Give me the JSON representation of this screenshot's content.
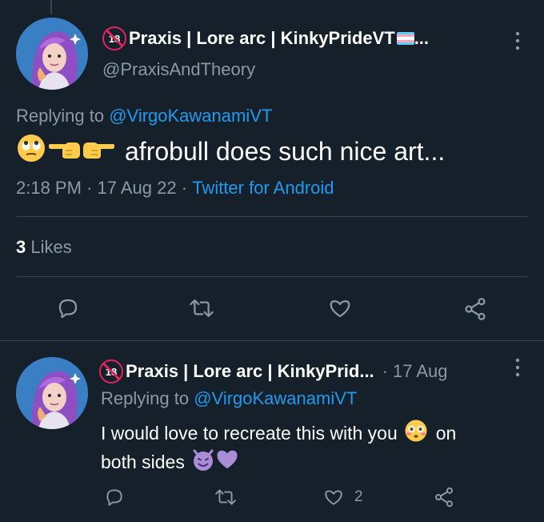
{
  "main_tweet": {
    "display_name": "Praxis | Lore arc | KinkyPrideVT",
    "display_name_ellipsis": "...",
    "handle": "@PraxisAndTheory",
    "age_badge": "18",
    "replying_prefix": "Replying to",
    "replying_to": "@VirgoKawanamiVT",
    "text": "afrobull does such nice art...",
    "time": "2:18 PM",
    "date": "17 Aug 22",
    "source": "Twitter for Android",
    "likes_count": "3",
    "likes_label": "Likes"
  },
  "reply_tweet": {
    "display_name": "Praxis | Lore arc | KinkyPrid...",
    "age_badge": "18",
    "date": "17 Aug",
    "replying_prefix": "Replying to",
    "replying_to": "@VirgoKawanamiVT",
    "text_part1": "I would love to recreate this with you",
    "text_part2": "on",
    "text_part3": "both sides",
    "like_count": "2"
  },
  "separators": {
    "dot": "·"
  },
  "icons": [
    "reply-icon",
    "retweet-icon",
    "like-icon",
    "share-icon",
    "more-icon"
  ],
  "colors": {
    "background": "#15202b",
    "link": "#1d9bf0",
    "muted": "#8b98a5",
    "divider": "#38444d",
    "badge": "#e0245e"
  }
}
